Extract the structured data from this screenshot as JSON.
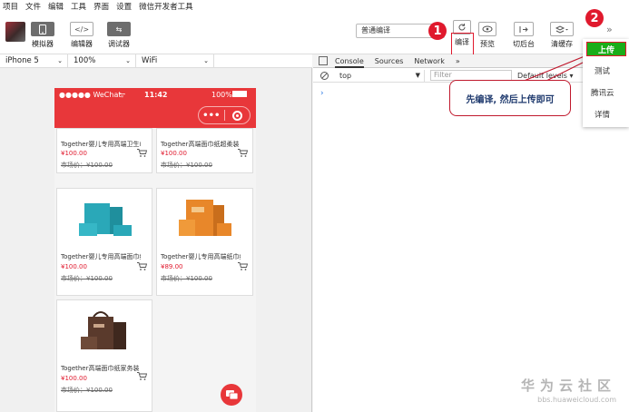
{
  "menu": [
    "项目",
    "文件",
    "编辑",
    "工具",
    "界面",
    "设置",
    "微信开发者工具"
  ],
  "toolbar": {
    "simulator_label": "模拟器",
    "simulator_icon": "phone-icon",
    "editor_label": "编辑器",
    "editor_icon": "</>",
    "debugger_label": "调试器",
    "debugger_icon": "⇆",
    "compile_mode": "普通编译",
    "compile_label": "编译",
    "preview_label": "预览",
    "background_label": "切后台",
    "clear_cache_label": "清缓存",
    "step1": "1",
    "step2": "2"
  },
  "device": {
    "model": "iPhone 5",
    "zoom": "100%",
    "network": "WiFi"
  },
  "phone": {
    "carrier": "●●●●● WeChat",
    "time": "11:42",
    "battery": "100%"
  },
  "products": [
    {
      "title": "Together婴儿专用高端卫生巾...",
      "price": "¥100.00",
      "market_price": "市场价：¥100.00"
    },
    {
      "title": "Together高端面巾纸超柔装",
      "price": "¥100.00",
      "market_price": "市场价：¥100.00"
    },
    {
      "title": "Together婴儿专用高端面巾纸...",
      "price": "¥100.00",
      "market_price": "市场价：¥100.00"
    },
    {
      "title": "Together婴儿专用高端纸巾组...",
      "price": "¥89.00",
      "market_price": "市场价：¥100.00"
    },
    {
      "title": "Together高端面巾纸家务装",
      "price": "¥100.00",
      "market_price": "市场价：¥100.00"
    }
  ],
  "devtools": {
    "tabs": [
      "Console",
      "Sources",
      "Network",
      "»"
    ],
    "context": "top",
    "filter_placeholder": "Filter",
    "levels": "Default levels ▾",
    "prompt": "›"
  },
  "callout": "先编译, 然后上传即可",
  "upload_menu": {
    "upload": "上传",
    "items": [
      "测试",
      "腾讯云",
      "详情"
    ]
  },
  "watermark": {
    "brand": "华为云社区",
    "url": "bbs.huaweicloud.com"
  },
  "colors": {
    "wechat_red": "#e8373a",
    "annotation_red": "#e0192d",
    "upload_green": "#1aad19"
  }
}
